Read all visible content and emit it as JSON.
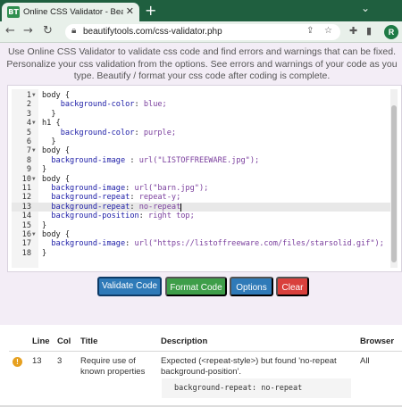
{
  "browser": {
    "tab_title": "Online CSS Validator - BeautifyTools",
    "favicon_text": "BT",
    "url": "beautifytools.com/css-validator.php",
    "avatar_letter": "R"
  },
  "intro_text": "Use Online CSS Validator to validate css code and find errors and warnings that can be fixed. Personalize your css validation from the options. See errors and warnings of your code as you type. Beautify / format your css code after coding is complete.",
  "editor": {
    "lines": [
      {
        "n": "1",
        "fold": true,
        "text": "body {"
      },
      {
        "n": "2",
        "fold": false,
        "text": "    background-color: blue;"
      },
      {
        "n": "3",
        "fold": false,
        "text": "  }"
      },
      {
        "n": "4",
        "fold": true,
        "text": "h1 {"
      },
      {
        "n": "5",
        "fold": false,
        "text": "    background-color: purple;"
      },
      {
        "n": "6",
        "fold": false,
        "text": "  }"
      },
      {
        "n": "7",
        "fold": true,
        "text": "body {"
      },
      {
        "n": "8",
        "fold": false,
        "text": "  background-image : url(\"LISTOFFREEWARE.jpg\");"
      },
      {
        "n": "9",
        "fold": false,
        "text": "}"
      },
      {
        "n": "10",
        "fold": true,
        "text": "body {"
      },
      {
        "n": "11",
        "fold": false,
        "text": "  background-image: url(\"barn.jpg\");"
      },
      {
        "n": "12",
        "fold": false,
        "text": "  background-repeat: repeat-y;"
      },
      {
        "n": "13",
        "fold": false,
        "text": "  background-repeat: no-repeat"
      },
      {
        "n": "14",
        "fold": false,
        "text": "  background-position: right top;"
      },
      {
        "n": "15",
        "fold": false,
        "text": "}"
      },
      {
        "n": "16",
        "fold": true,
        "text": "body {"
      },
      {
        "n": "17",
        "fold": false,
        "text": "  background-image: url(\"https://listoffreeware.com/files/starsolid.gif\");"
      },
      {
        "n": "18",
        "fold": false,
        "text": "}"
      }
    ],
    "active_line": "13"
  },
  "buttons": {
    "validate": "Validate Code",
    "format": "Format Code",
    "options": "Options",
    "clear": "Clear"
  },
  "results": {
    "headers": {
      "line": "Line",
      "col": "Col",
      "title": "Title",
      "description": "Description",
      "browser": "Browser"
    },
    "rows": [
      {
        "line": "13",
        "col": "3",
        "title_1": "Require use of",
        "title_2": "known properties",
        "desc_1": "Expected (<repeat-style>) but found 'no-repeat",
        "desc_2": "background-position'.",
        "snippet": "background-repeat: no-repeat",
        "browser": "All"
      }
    ]
  },
  "colors": {
    "validate": "#2f7ab8",
    "format": "#3e9e49",
    "clear": "#d9403c",
    "warning": "#e6a020"
  }
}
